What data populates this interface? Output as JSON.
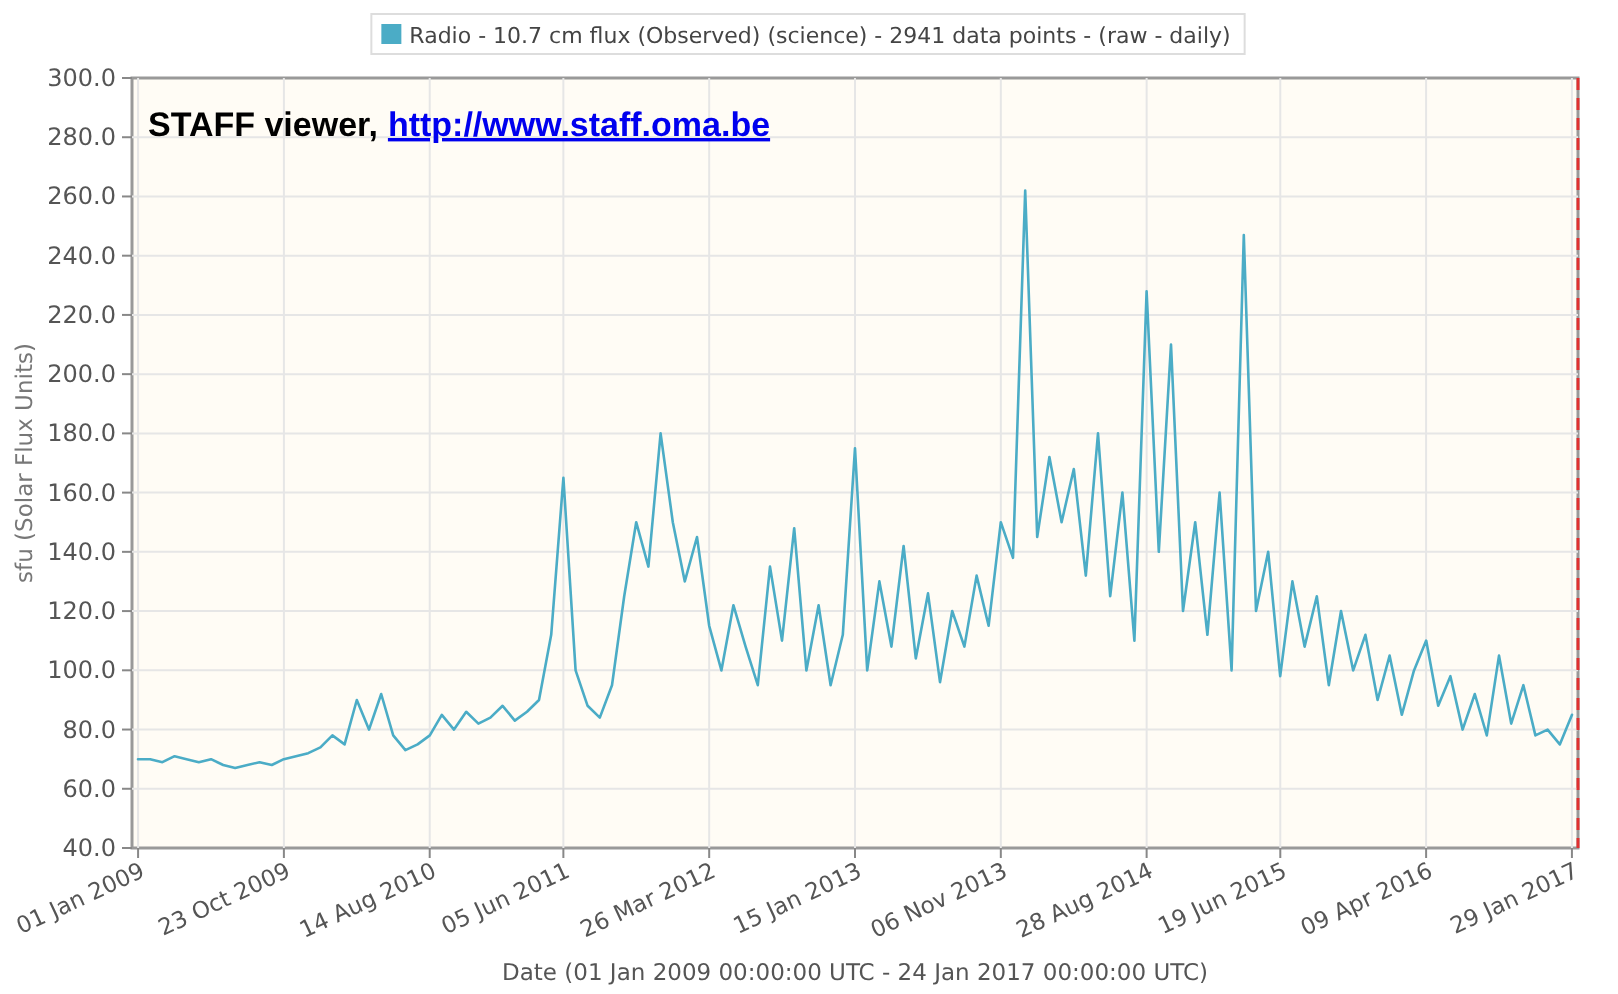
{
  "chart": {
    "annotation": {
      "text": "STAFF viewer,",
      "link": "http://www.staff.oma.be"
    },
    "chart_data": {
      "type": "line",
      "xlabel": "Date (01 Jan 2009 00:00:00 UTC - 24 Jan 2017 00:00:00 UTC)",
      "ylabel": "sfu (Solar Flux Units)",
      "grid": true,
      "ylim": [
        40,
        300
      ],
      "categories": [
        "01 Jan 2009",
        null,
        null,
        null,
        null,
        null,
        null,
        null,
        null,
        null,
        null,
        null,
        "23 Oct 2009",
        null,
        null,
        null,
        null,
        null,
        null,
        null,
        null,
        null,
        null,
        null,
        "14 Aug 2010",
        null,
        null,
        null,
        null,
        null,
        null,
        null,
        null,
        null,
        null,
        "05 Jun 2011",
        null,
        null,
        null,
        null,
        null,
        null,
        null,
        null,
        null,
        null,
        null,
        "26 Mar 2012",
        null,
        null,
        null,
        null,
        null,
        null,
        null,
        null,
        null,
        null,
        null,
        "15 Jan 2013",
        null,
        null,
        null,
        null,
        null,
        null,
        null,
        null,
        null,
        null,
        null,
        "06 Nov 2013",
        null,
        null,
        null,
        null,
        null,
        null,
        null,
        null,
        null,
        null,
        null,
        "28 Aug 2014",
        null,
        null,
        null,
        null,
        null,
        null,
        null,
        null,
        null,
        null,
        "19 Jun 2015",
        null,
        null,
        null,
        null,
        null,
        null,
        null,
        null,
        null,
        null,
        null,
        "09 Apr 2016",
        null,
        null,
        null,
        null,
        null,
        null,
        null,
        null,
        null,
        null,
        null,
        "29 Jan 2017"
      ],
      "yticks": [
        {
          "value": 40,
          "label": "40.0"
        },
        {
          "value": 60,
          "label": "60.0"
        },
        {
          "value": 80,
          "label": "80.0"
        },
        {
          "value": 100,
          "label": "100.0"
        },
        {
          "value": 120,
          "label": "120.0"
        },
        {
          "value": 140,
          "label": "140.0"
        },
        {
          "value": 160,
          "label": "160.0"
        },
        {
          "value": 180,
          "label": "180.0"
        },
        {
          "value": 200,
          "label": "200.0"
        },
        {
          "value": 220,
          "label": "220.0"
        },
        {
          "value": 240,
          "label": "240.0"
        },
        {
          "value": 260,
          "label": "260.0"
        },
        {
          "value": 280,
          "label": "280.0"
        },
        {
          "value": 300,
          "label": "300.0"
        }
      ],
      "series": [
        {
          "name": "Radio - 10.7 cm flux (Observed) (science) - 2941 data points -  (raw - daily)",
          "color": "#4bacc6",
          "values": [
            70,
            70,
            69,
            71,
            70,
            69,
            70,
            68,
            67,
            68,
            69,
            68,
            70,
            71,
            72,
            74,
            78,
            75,
            90,
            80,
            92,
            78,
            73,
            75,
            78,
            85,
            80,
            86,
            82,
            84,
            88,
            83,
            86,
            90,
            112,
            165,
            100,
            88,
            84,
            95,
            125,
            150,
            135,
            180,
            150,
            130,
            145,
            115,
            100,
            122,
            108,
            95,
            135,
            110,
            148,
            100,
            122,
            95,
            112,
            175,
            100,
            130,
            108,
            142,
            104,
            126,
            96,
            120,
            108,
            132,
            115,
            150,
            138,
            262,
            145,
            172,
            150,
            168,
            132,
            180,
            125,
            160,
            110,
            228,
            140,
            210,
            120,
            150,
            112,
            160,
            100,
            247,
            120,
            140,
            98,
            130,
            108,
            125,
            95,
            120,
            100,
            112,
            90,
            105,
            85,
            100,
            110,
            88,
            98,
            80,
            92,
            78,
            105,
            82,
            95,
            78,
            80,
            75,
            85
          ]
        }
      ]
    }
  }
}
